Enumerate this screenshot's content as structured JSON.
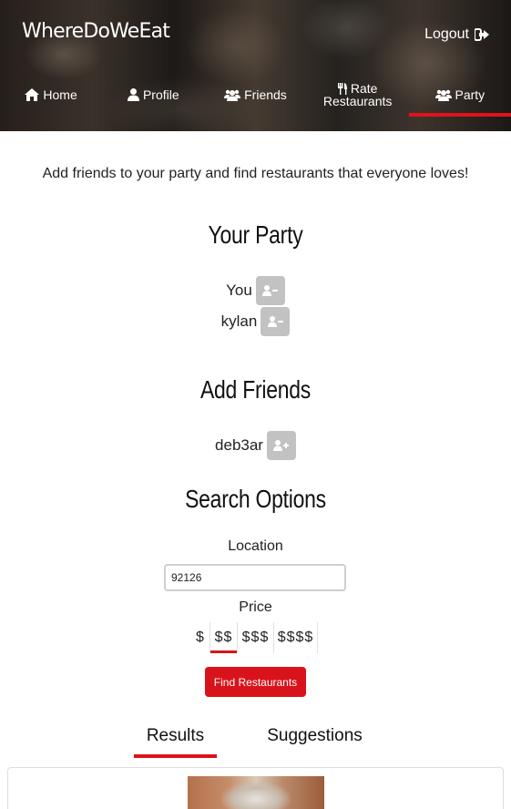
{
  "app": {
    "brand": "WhereDoWeEat",
    "logout_label": "Logout"
  },
  "nav": {
    "items": [
      {
        "label": "Home",
        "icon": "home-icon"
      },
      {
        "label": "Profile",
        "icon": "user-icon"
      },
      {
        "label": "Friends",
        "icon": "users-icon"
      },
      {
        "label_line1": "Rate",
        "label_line2": "Restaurants",
        "icon": "utensils-icon"
      },
      {
        "label": "Party",
        "icon": "users-icon",
        "active": true
      }
    ]
  },
  "main": {
    "tagline": "Add friends to your party and find restaurants that everyone loves!",
    "party": {
      "title": "Your Party",
      "members": [
        "You",
        "kylan"
      ]
    },
    "add_friends": {
      "title": "Add Friends",
      "friends": [
        "deb3ar"
      ]
    },
    "search": {
      "title": "Search Options",
      "location_label": "Location",
      "location_value": "92126",
      "price_label": "Price",
      "price_options": [
        "$",
        "$$",
        "$$$",
        "$$$$"
      ],
      "price_selected": "$$",
      "find_button": "Find Restaurants"
    },
    "tabs": {
      "results": "Results",
      "suggestions": "Suggestions",
      "active": "Results"
    }
  },
  "colors": {
    "accent": "#d9131b",
    "button_gray": "#c2c2c2"
  }
}
